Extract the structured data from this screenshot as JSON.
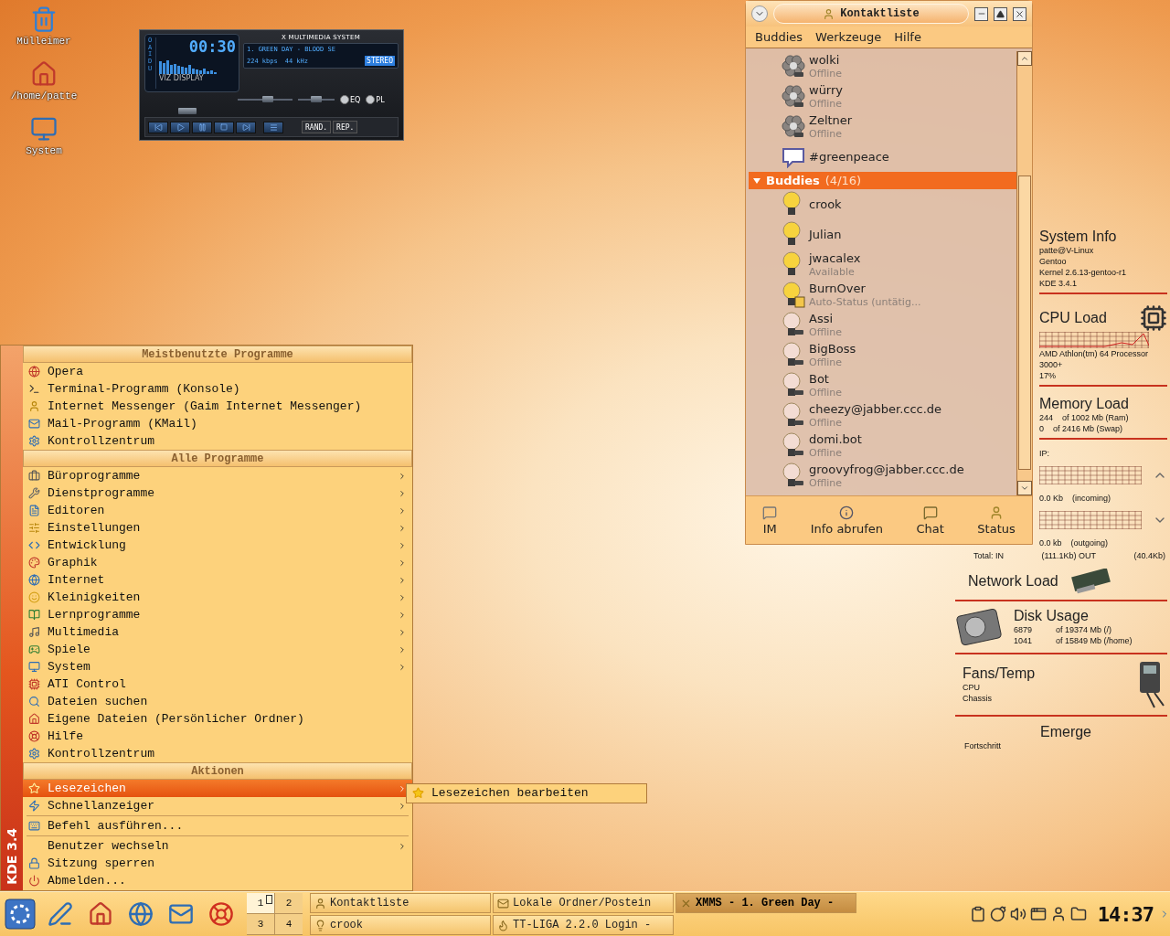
{
  "desktop_icons": [
    {
      "label": "Mülleimer"
    },
    {
      "label": "/home/patte"
    },
    {
      "label": "System"
    }
  ],
  "xmms": {
    "side_label": "OAIDU",
    "viz_label": "VIZ DISPLAY",
    "time": "00:30",
    "title": "X MULTIMEDIA SYSTEM",
    "track": "1. GREEN DAY - BLOOD SE",
    "bitrate": "224 kbps",
    "samplerate": "44 kHz",
    "stereo": {
      "label": "STEREO",
      "on": true
    },
    "volume": {
      "level": 0.55
    },
    "balance": {
      "level": 0.5
    },
    "toggles": [
      {
        "label": "EQ",
        "on": false
      },
      {
        "label": "PL",
        "on": false
      }
    ],
    "seek": {
      "level": 0.15
    },
    "mode_buttons": [
      "RAND.",
      "REP."
    ]
  },
  "contact_list": {
    "title": "Kontaktliste",
    "menu": [
      "Buddies",
      "Werkzeuge",
      "Hilfe"
    ],
    "rows": [
      {
        "kind": "icq",
        "name": "wolki",
        "online": false,
        "away": false,
        "status_text": "Offline"
      },
      {
        "kind": "icq",
        "name": "würry",
        "online": false,
        "away": false,
        "status_text": "Offline"
      },
      {
        "kind": "icq",
        "name": "Zeltner",
        "online": false,
        "away": false,
        "status_text": "Offline"
      },
      {
        "kind": "chat",
        "name": "#greenpeace"
      },
      {
        "kind": "group",
        "name": "Buddies",
        "count": "(4/16)",
        "expanded": true
      },
      {
        "kind": "jabber",
        "name": "crook",
        "online": true,
        "away": false
      },
      {
        "kind": "jabber",
        "name": "Julian",
        "online": true,
        "away": false
      },
      {
        "kind": "jabber",
        "name": "jwacalex",
        "online": true,
        "away": false,
        "status_text": "Available"
      },
      {
        "kind": "jabber",
        "name": "BurnOver",
        "online": true,
        "away": true,
        "status_text": "Auto-Status (untätig..."
      },
      {
        "kind": "jabber",
        "name": "Assi",
        "online": false,
        "away": false,
        "status_text": "Offline"
      },
      {
        "kind": "jabber",
        "name": "BigBoss",
        "online": false,
        "away": false,
        "status_text": "Offline"
      },
      {
        "kind": "jabber",
        "name": "Bot",
        "online": false,
        "away": false,
        "status_text": "Offline"
      },
      {
        "kind": "jabber",
        "name": "cheezy@jabber.ccc.de",
        "online": false,
        "away": false,
        "status_text": "Offline"
      },
      {
        "kind": "jabber",
        "name": "domi.bot",
        "online": false,
        "away": false,
        "status_text": "Offline"
      },
      {
        "kind": "jabber",
        "name": "groovyfrog@jabber.ccc.de",
        "online": false,
        "away": false,
        "status_text": "Offline"
      }
    ],
    "toolbar": [
      "IM",
      "Info abrufen",
      "Chat",
      "Status"
    ]
  },
  "system_monitor": {
    "system_info": {
      "title": "System Info",
      "lines": [
        "patte@V-Linux",
        "Gentoo",
        "Kernel 2.6.13-gentoo-r1",
        "KDE 3.4.1"
      ]
    },
    "cpu_load": {
      "title": "CPU Load",
      "processor": "AMD Athlon(tm) 64 Processor 3000+",
      "value": "17%"
    },
    "memory_load": {
      "title": "Memory Load",
      "rows": [
        {
          "used": "244",
          "total": "of 1002 Mb (Ram)"
        },
        {
          "used": "0",
          "total": "of 2416 Mb (Swap)"
        }
      ]
    },
    "network": {
      "ip_label": "IP:",
      "incoming": {
        "value": "0.0 Kb",
        "label": "(incoming)"
      },
      "outgoing": {
        "value": "0.0 kb",
        "label": "(outgoing)"
      },
      "totals": [
        "Total: IN",
        "(111.1Kb) OUT",
        "(40.4Kb)"
      ],
      "title": "Network Load"
    },
    "disk_usage": {
      "title": "Disk Usage",
      "rows": [
        {
          "used": "6879",
          "total": "of 19374 Mb (/)"
        },
        {
          "used": "1041",
          "total": "of 15849 Mb (/home)"
        }
      ]
    },
    "fans_temp": {
      "title": "Fans/Temp",
      "labels": [
        "CPU",
        "Chassis"
      ]
    },
    "emerge": {
      "title": "Emerge",
      "label": "Fortschritt"
    }
  },
  "start_menu": {
    "side_label": "KDE 3.4",
    "items": [
      {
        "kind": "header",
        "label": "Meistbenutzte Programme"
      },
      {
        "kind": "item",
        "label": "Opera",
        "submenu": false,
        "selected": false
      },
      {
        "kind": "item",
        "label": "Terminal-Programm (Konsole)",
        "submenu": false,
        "selected": false
      },
      {
        "kind": "item",
        "label": "Internet Messenger (Gaim Internet Messenger)",
        "submenu": false,
        "selected": false
      },
      {
        "kind": "item",
        "label": "Mail-Programm (KMail)",
        "submenu": false,
        "selected": false
      },
      {
        "kind": "item",
        "label": "Kontrollzentrum",
        "submenu": false,
        "selected": false
      },
      {
        "kind": "header",
        "label": "Alle Programme"
      },
      {
        "kind": "item",
        "label": "Büroprogramme",
        "submenu": true,
        "selected": false
      },
      {
        "kind": "item",
        "label": "Dienstprogramme",
        "submenu": true,
        "selected": false
      },
      {
        "kind": "item",
        "label": "Editoren",
        "submenu": true,
        "selected": false
      },
      {
        "kind": "item",
        "label": "Einstellungen",
        "submenu": true,
        "selected": false
      },
      {
        "kind": "item",
        "label": "Entwicklung",
        "submenu": true,
        "selected": false
      },
      {
        "kind": "item",
        "label": "Graphik",
        "submenu": true,
        "selected": false
      },
      {
        "kind": "item",
        "label": "Internet",
        "submenu": true,
        "selected": false
      },
      {
        "kind": "item",
        "label": "Kleinigkeiten",
        "submenu": true,
        "selected": false
      },
      {
        "kind": "item",
        "label": "Lernprogramme",
        "submenu": true,
        "selected": false
      },
      {
        "kind": "item",
        "label": "Multimedia",
        "submenu": true,
        "selected": false
      },
      {
        "kind": "item",
        "label": "Spiele",
        "submenu": true,
        "selected": false
      },
      {
        "kind": "item",
        "label": "System",
        "submenu": true,
        "selected": false
      },
      {
        "kind": "item",
        "label": "ATI Control",
        "submenu": false,
        "selected": false
      },
      {
        "kind": "item",
        "label": "Dateien suchen",
        "submenu": false,
        "selected": false
      },
      {
        "kind": "item",
        "label": "Eigene Dateien (Persönlicher Ordner)",
        "submenu": false,
        "selected": false
      },
      {
        "kind": "item",
        "label": "Hilfe",
        "submenu": false,
        "selected": false
      },
      {
        "kind": "item",
        "label": "Kontrollzentrum",
        "submenu": false,
        "selected": false
      },
      {
        "kind": "header",
        "label": "Aktionen"
      },
      {
        "kind": "item",
        "label": "Lesezeichen",
        "submenu": true,
        "selected": true
      },
      {
        "kind": "item",
        "label": "Schnellanzeiger",
        "submenu": true,
        "selected": false
      },
      {
        "kind": "separator"
      },
      {
        "kind": "item",
        "label": "Befehl ausführen...",
        "submenu": false,
        "selected": false
      },
      {
        "kind": "separator"
      },
      {
        "kind": "item",
        "label": "Benutzer wechseln",
        "submenu": true,
        "selected": false
      },
      {
        "kind": "item",
        "label": "Sitzung sperren",
        "submenu": false,
        "selected": false
      },
      {
        "kind": "item",
        "label": "Abmelden...",
        "submenu": false,
        "selected": false
      }
    ],
    "submenu": [
      {
        "label": "Lesezeichen bearbeiten"
      }
    ]
  },
  "taskbar": {
    "pager": [
      {
        "label": "1",
        "selected": true
      },
      {
        "label": "2",
        "selected": false
      },
      {
        "label": "3",
        "selected": false
      },
      {
        "label": "4",
        "selected": false
      }
    ],
    "tasks": [
      {
        "label": "Kontaktliste",
        "selected": false
      },
      {
        "label": "crook",
        "selected": false
      },
      {
        "label": "Lokale Ordner/Postein",
        "selected": false
      },
      {
        "label": "TT-LIGA 2.2.0 Login -",
        "selected": false
      },
      {
        "label": "XMMS - 1. Green Day -",
        "selected": true
      }
    ],
    "clock": "14:37"
  }
}
